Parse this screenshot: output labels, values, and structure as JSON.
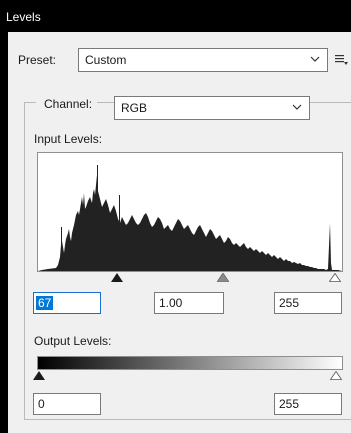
{
  "window": {
    "title": "Levels"
  },
  "preset": {
    "label": "Preset:",
    "value": "Custom"
  },
  "channel": {
    "label": "Channel:",
    "value": "RGB"
  },
  "input_levels": {
    "label": "Input Levels:",
    "black": "67",
    "gamma": "1.00",
    "white": "255"
  },
  "output_levels": {
    "label": "Output Levels:",
    "black": "0",
    "white": "255"
  },
  "colors": {
    "accent": "#0078d7",
    "histogram_fill": "#222222",
    "arrow_black": "#1a1a1a",
    "arrow_gray": "#8a8a8a",
    "arrow_white": "#ffffff"
  }
}
